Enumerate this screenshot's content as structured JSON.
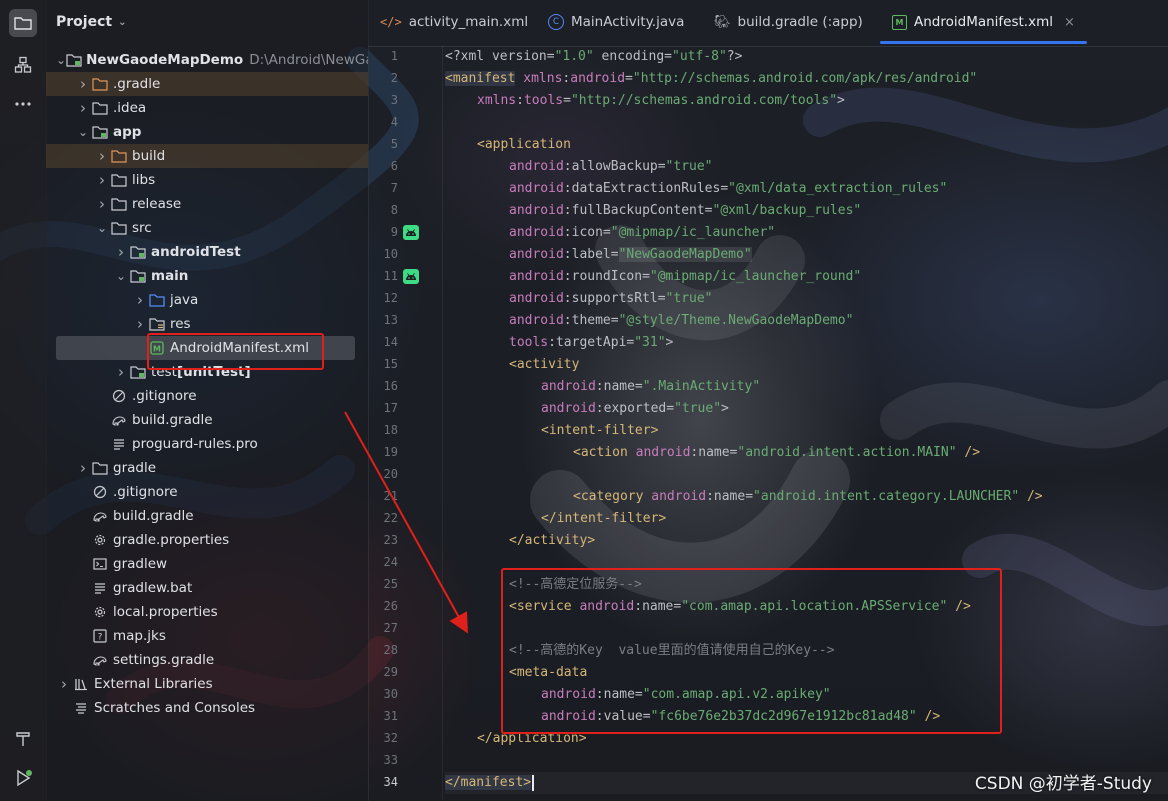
{
  "colors": {
    "accent": "#3574f0",
    "annotation": "#e0201a",
    "xml_tag": "#d5b778",
    "xml_prefix": "#c77dbb",
    "xml_value": "#6aab73",
    "comment": "#7a7e85"
  },
  "toolstrip": {
    "top": [
      {
        "icon": "folder-icon"
      },
      {
        "icon": "structure-icon"
      },
      {
        "icon": "more-icon"
      }
    ],
    "bottom": [
      {
        "icon": "hammer-icon"
      },
      {
        "icon": "run-icon"
      }
    ]
  },
  "project": {
    "title": "Project",
    "tree": [
      {
        "label": "NewGaodeMapDemo",
        "path": "D:\\Android\\NewGaoc",
        "icon": "module",
        "depth": 0,
        "open": true,
        "bold": true
      },
      {
        "label": ".gradle",
        "icon": "folder-orange",
        "depth": 1,
        "open": false,
        "highlight": true
      },
      {
        "label": ".idea",
        "icon": "folder",
        "depth": 1,
        "open": false
      },
      {
        "label": "app",
        "icon": "module",
        "depth": 1,
        "open": true,
        "bold": true
      },
      {
        "label": "build",
        "icon": "folder-orange",
        "depth": 2,
        "open": false,
        "highlight": true
      },
      {
        "label": "libs",
        "icon": "folder",
        "depth": 2,
        "open": false
      },
      {
        "label": "release",
        "icon": "folder",
        "depth": 2,
        "open": false
      },
      {
        "label": "src",
        "icon": "folder",
        "depth": 2,
        "open": true
      },
      {
        "label": "androidTest",
        "icon": "folder-test",
        "depth": 3,
        "open": false,
        "bold": true
      },
      {
        "label": "main",
        "icon": "folder-test",
        "depth": 3,
        "open": true,
        "bold": true
      },
      {
        "label": "java",
        "icon": "folder-blue",
        "depth": 4,
        "open": false
      },
      {
        "label": "res",
        "icon": "folder-res",
        "depth": 4,
        "open": false
      },
      {
        "label": "AndroidManifest.xml",
        "icon": "manifest",
        "depth": 4,
        "leaf": true,
        "selected": true
      },
      {
        "label": "test",
        "tag": "[unitTest]",
        "icon": "folder-test",
        "depth": 3,
        "open": false
      },
      {
        "label": ".gitignore",
        "icon": "ignore",
        "depth": 2,
        "leaf": true
      },
      {
        "label": "build.gradle",
        "icon": "gradle",
        "depth": 2,
        "leaf": true
      },
      {
        "label": "proguard-rules.pro",
        "icon": "text",
        "depth": 2,
        "leaf": true
      },
      {
        "label": "gradle",
        "icon": "folder",
        "depth": 1,
        "open": false
      },
      {
        "label": ".gitignore",
        "icon": "ignore",
        "depth": 1,
        "leaf": true
      },
      {
        "label": "build.gradle",
        "icon": "gradle",
        "depth": 1,
        "leaf": true
      },
      {
        "label": "gradle.properties",
        "icon": "settings",
        "depth": 1,
        "leaf": true
      },
      {
        "label": "gradlew",
        "icon": "terminal",
        "depth": 1,
        "leaf": true
      },
      {
        "label": "gradlew.bat",
        "icon": "text",
        "depth": 1,
        "leaf": true
      },
      {
        "label": "local.properties",
        "icon": "settings",
        "depth": 1,
        "leaf": true
      },
      {
        "label": "map.jks",
        "icon": "unknown",
        "depth": 1,
        "leaf": true
      },
      {
        "label": "settings.gradle",
        "icon": "gradle",
        "depth": 1,
        "leaf": true
      },
      {
        "label": "External Libraries",
        "icon": "library",
        "depth": 0,
        "open": false
      },
      {
        "label": "Scratches and Consoles",
        "icon": "scratches",
        "depth": 0,
        "leaf": true
      }
    ]
  },
  "tabs": [
    {
      "label": "activity_main.xml",
      "icon": "xml-icon"
    },
    {
      "label": "MainActivity.java",
      "icon": "class-icon"
    },
    {
      "label": "build.gradle (:app)",
      "icon": "gradle-icon"
    },
    {
      "label": "AndroidManifest.xml",
      "icon": "manifest-icon",
      "active": true,
      "close": "×"
    }
  ],
  "editor": {
    "current_line": 34,
    "gutter_icons": [
      9,
      11
    ],
    "lines": [
      {
        "n": "1",
        "ind": 0,
        "tokens": [
          [
            "pun",
            "<?xml version="
          ],
          [
            "val",
            "\"1.0\""
          ],
          [
            "pun",
            " encoding="
          ],
          [
            "val",
            "\"utf-8\""
          ],
          [
            "pun",
            "?>"
          ]
        ]
      },
      {
        "n": "2",
        "ind": 0,
        "tokens": [
          [
            "tag",
            "<manifest",
            "manifestTag"
          ],
          [
            "pun",
            " "
          ],
          [
            "pre",
            "xmlns"
          ],
          [
            "pun",
            ":"
          ],
          [
            "pre",
            "android"
          ],
          [
            "pun",
            "="
          ],
          [
            "val",
            "\"http://schemas.android.com/apk/res/android\""
          ]
        ]
      },
      {
        "n": "3",
        "ind": 1,
        "tokens": [
          [
            "pre",
            "xmlns"
          ],
          [
            "pun",
            ":"
          ],
          [
            "pre",
            "tools"
          ],
          [
            "pun",
            "="
          ],
          [
            "val",
            "\"http://schemas.android.com/tools\""
          ],
          [
            "pun",
            ">"
          ]
        ]
      },
      {
        "n": "4",
        "ind": 0,
        "tokens": []
      },
      {
        "n": "5",
        "ind": 1,
        "tokens": [
          [
            "tag",
            "<application"
          ]
        ]
      },
      {
        "n": "6",
        "ind": 2,
        "tokens": [
          [
            "pre",
            "android"
          ],
          [
            "pun",
            ":allowBackup="
          ],
          [
            "val",
            "\"true\""
          ]
        ]
      },
      {
        "n": "7",
        "ind": 2,
        "tokens": [
          [
            "pre",
            "android"
          ],
          [
            "pun",
            ":dataExtractionRules="
          ],
          [
            "val",
            "\"@xml/data_extraction_rules\""
          ]
        ]
      },
      {
        "n": "8",
        "ind": 2,
        "tokens": [
          [
            "pre",
            "android"
          ],
          [
            "pun",
            ":fullBackupContent="
          ],
          [
            "val",
            "\"@xml/backup_rules\""
          ]
        ]
      },
      {
        "n": "9",
        "ind": 2,
        "tokens": [
          [
            "pre",
            "android"
          ],
          [
            "pun",
            ":icon="
          ],
          [
            "val",
            "\"@mipmap/ic_launcher\""
          ]
        ]
      },
      {
        "n": "10",
        "ind": 2,
        "tokens": [
          [
            "pre",
            "android"
          ],
          [
            "pun",
            ":label="
          ],
          [
            "val",
            "\"NewGaodeMapDemo\"",
            "valbox"
          ]
        ]
      },
      {
        "n": "11",
        "ind": 2,
        "tokens": [
          [
            "pre",
            "android"
          ],
          [
            "pun",
            ":roundIcon="
          ],
          [
            "val",
            "\"@mipmap/ic_launcher_round\""
          ]
        ]
      },
      {
        "n": "12",
        "ind": 2,
        "tokens": [
          [
            "pre",
            "android"
          ],
          [
            "pun",
            ":supportsRtl="
          ],
          [
            "val",
            "\"true\""
          ]
        ]
      },
      {
        "n": "13",
        "ind": 2,
        "tokens": [
          [
            "pre",
            "android"
          ],
          [
            "pun",
            ":theme="
          ],
          [
            "val",
            "\"@style/Theme.NewGaodeMapDemo\""
          ]
        ]
      },
      {
        "n": "14",
        "ind": 2,
        "tokens": [
          [
            "pre",
            "tools"
          ],
          [
            "pun",
            ":targetApi="
          ],
          [
            "val",
            "\"31\""
          ],
          [
            "pun",
            ">"
          ]
        ]
      },
      {
        "n": "15",
        "ind": 2,
        "tokens": [
          [
            "tag",
            "<activity"
          ]
        ]
      },
      {
        "n": "16",
        "ind": 3,
        "tokens": [
          [
            "pre",
            "android"
          ],
          [
            "pun",
            ":name="
          ],
          [
            "val",
            "\".MainActivity\""
          ]
        ]
      },
      {
        "n": "17",
        "ind": 3,
        "tokens": [
          [
            "pre",
            "android"
          ],
          [
            "pun",
            ":exported="
          ],
          [
            "val",
            "\"true\""
          ],
          [
            "pun",
            ">"
          ]
        ]
      },
      {
        "n": "18",
        "ind": 3,
        "tokens": [
          [
            "tag",
            "<intent-filter"
          ],
          [
            "tag",
            ">"
          ]
        ]
      },
      {
        "n": "19",
        "ind": 4,
        "tokens": [
          [
            "tag",
            "<action"
          ],
          [
            "pun",
            " "
          ],
          [
            "pre",
            "android"
          ],
          [
            "pun",
            ":name="
          ],
          [
            "val",
            "\"android.intent.action.MAIN\""
          ],
          [
            "pun",
            " "
          ],
          [
            "tag",
            "/>"
          ]
        ]
      },
      {
        "n": "20",
        "ind": 0,
        "tokens": []
      },
      {
        "n": "21",
        "ind": 4,
        "tokens": [
          [
            "tag",
            "<category"
          ],
          [
            "pun",
            " "
          ],
          [
            "pre",
            "android"
          ],
          [
            "pun",
            ":name="
          ],
          [
            "val",
            "\"android.intent.category.LAUNCHER\""
          ],
          [
            "pun",
            " "
          ],
          [
            "tag",
            "/>"
          ]
        ]
      },
      {
        "n": "22",
        "ind": 3,
        "tokens": [
          [
            "tag",
            "</intent-filter>"
          ]
        ]
      },
      {
        "n": "23",
        "ind": 2,
        "tokens": [
          [
            "tag",
            "</activity>"
          ]
        ]
      },
      {
        "n": "24",
        "ind": 0,
        "tokens": []
      },
      {
        "n": "25",
        "ind": 2,
        "tokens": [
          [
            "cmt",
            "<!--高德定位服务-->"
          ]
        ]
      },
      {
        "n": "26",
        "ind": 2,
        "tokens": [
          [
            "tag",
            "<service"
          ],
          [
            "pun",
            " "
          ],
          [
            "pre",
            "android"
          ],
          [
            "pun",
            ":name="
          ],
          [
            "val",
            "\"com.amap.api.location.APSService\""
          ],
          [
            "pun",
            " "
          ],
          [
            "tag",
            "/>"
          ]
        ]
      },
      {
        "n": "27",
        "ind": 0,
        "tokens": []
      },
      {
        "n": "28",
        "ind": 2,
        "tokens": [
          [
            "cmt",
            "<!--高德的Key  value里面的值请使用自己的Key-->"
          ]
        ]
      },
      {
        "n": "29",
        "ind": 2,
        "tokens": [
          [
            "tag",
            "<meta-data"
          ]
        ]
      },
      {
        "n": "30",
        "ind": 3,
        "tokens": [
          [
            "pre",
            "android"
          ],
          [
            "pun",
            ":name="
          ],
          [
            "val",
            "\"com.amap.api.v2.apikey\""
          ]
        ]
      },
      {
        "n": "31",
        "ind": 3,
        "tokens": [
          [
            "pre",
            "android"
          ],
          [
            "pun",
            ":value="
          ],
          [
            "val",
            "\"fc6be76e2b37dc2d967e1912bc81ad48\""
          ],
          [
            "pun",
            " "
          ],
          [
            "tag",
            "/>"
          ]
        ]
      },
      {
        "n": "32",
        "ind": 1,
        "tokens": [
          [
            "tag",
            "</application>"
          ]
        ]
      },
      {
        "n": "33",
        "ind": 0,
        "tokens": []
      },
      {
        "n": "34",
        "ind": 0,
        "tokens": [
          [
            "tag",
            "</manifest>",
            "manifestTag"
          ]
        ],
        "caret": true
      }
    ]
  },
  "watermark": "CSDN @初学者-Study"
}
